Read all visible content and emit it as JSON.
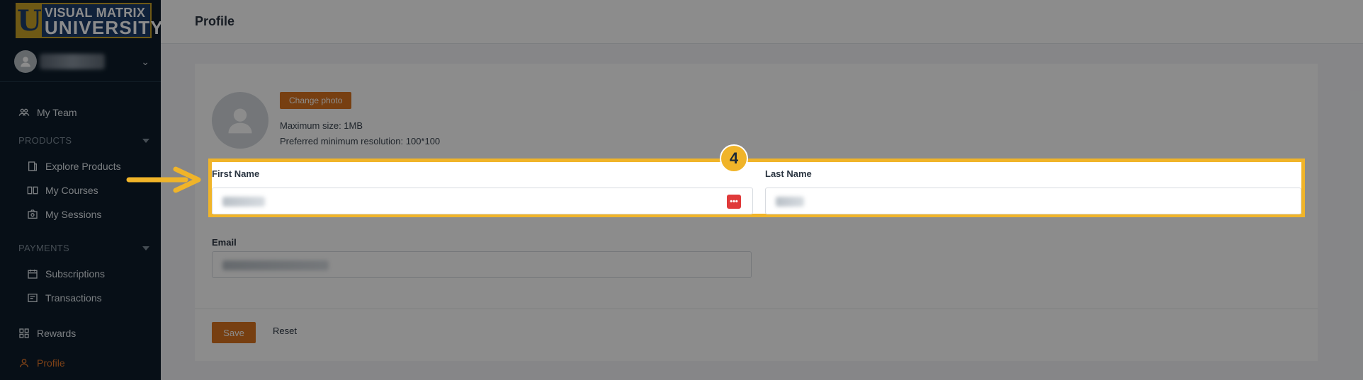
{
  "brand": {
    "logo_letter": "U",
    "line1": "VISUAL MATRIX",
    "line2": "UNIVERSITY"
  },
  "sidebar": {
    "items": [
      {
        "label": "My Team",
        "icon": "team-icon"
      },
      {
        "label": "Explore Products",
        "icon": "catalog-icon"
      },
      {
        "label": "My Courses",
        "icon": "book-icon"
      },
      {
        "label": "My Sessions",
        "icon": "sessions-icon"
      },
      {
        "label": "Subscriptions",
        "icon": "calendar-icon"
      },
      {
        "label": "Transactions",
        "icon": "receipt-icon"
      },
      {
        "label": "Rewards",
        "icon": "grid-icon"
      },
      {
        "label": "Profile",
        "icon": "user-icon"
      }
    ],
    "sections": {
      "products": "PRODUCTS",
      "payments": "PAYMENTS"
    }
  },
  "header": {
    "title": "Profile"
  },
  "profile": {
    "change_photo": "Change photo",
    "max_size": "Maximum size: 1MB",
    "resolution": "Preferred minimum resolution: 100*100",
    "first_name_label": "First Name",
    "last_name_label": "Last Name",
    "email_label": "Email",
    "save": "Save",
    "reset": "Reset"
  },
  "overlay": {
    "step_number": "4",
    "highlight_color": "#f0b429"
  },
  "colors": {
    "accent": "#d9741f",
    "sidebar_bg": "#0e1d2b",
    "highlight": "#f0b429"
  }
}
